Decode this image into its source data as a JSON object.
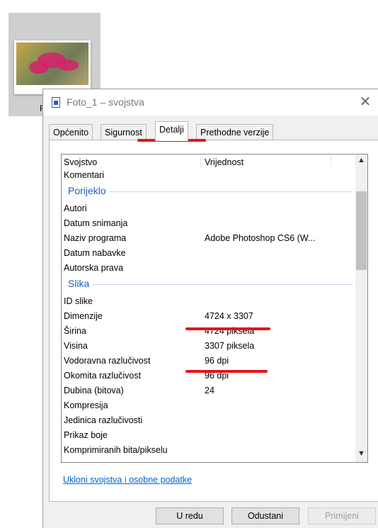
{
  "desktop": {
    "file_label": "F"
  },
  "window": {
    "title": "Foto_1 – svojstva",
    "tabs": [
      {
        "label": "Općenito"
      },
      {
        "label": "Sigurnost"
      },
      {
        "label": "Detalji",
        "active": true
      },
      {
        "label": "Prethodne verzije"
      }
    ],
    "list": {
      "columns": {
        "property": "Svojstvo",
        "value": "Vrijednost"
      },
      "top_row": {
        "k": "Komentari",
        "v": ""
      },
      "group_origin": "Porijeklo",
      "origin_rows": [
        {
          "k": "Autori",
          "v": ""
        },
        {
          "k": "Datum snimanja",
          "v": ""
        },
        {
          "k": "Naziv programa",
          "v": "Adobe Photoshop CS6 (W..."
        },
        {
          "k": "Datum nabavke",
          "v": ""
        },
        {
          "k": "Autorska prava",
          "v": ""
        }
      ],
      "group_image": "Slika",
      "image_rows": [
        {
          "k": "ID slike",
          "v": ""
        },
        {
          "k": "Dimenzije",
          "v": "4724 x 3307"
        },
        {
          "k": "Širina",
          "v": "4724 piksela"
        },
        {
          "k": "Visina",
          "v": "3307 piksela"
        },
        {
          "k": "Vodoravna razlučivost",
          "v": "96 dpi"
        },
        {
          "k": "Okomita razlučivost",
          "v": "96 dpi"
        },
        {
          "k": "Dubina (bitova)",
          "v": "24"
        },
        {
          "k": "Kompresija",
          "v": ""
        },
        {
          "k": "Jedinica razlučivosti",
          "v": ""
        },
        {
          "k": "Prikaz boje",
          "v": ""
        },
        {
          "k": "Komprimiranih bita/pikselu",
          "v": ""
        }
      ]
    },
    "remove_link": "Ukloni svojstva i osobne podatke",
    "buttons": {
      "ok": "U redu",
      "cancel": "Odustani",
      "apply": "Primijeni"
    }
  },
  "colors": {
    "annotation": "#e3141b",
    "group_header": "#1e5fb4",
    "link": "#0066cc"
  }
}
